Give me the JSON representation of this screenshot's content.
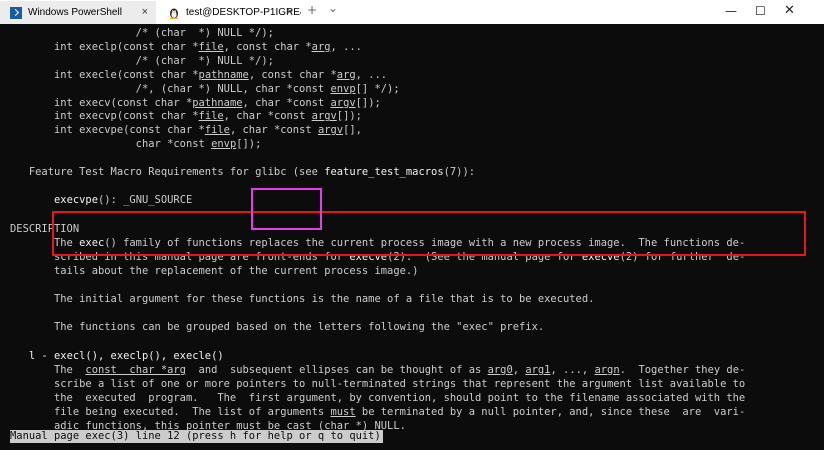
{
  "tabs": [
    {
      "title": "Windows PowerShell",
      "icon": "powershell-icon",
      "active": false
    },
    {
      "title": "test@DESKTOP-P1IGRE4: ~/data",
      "icon": "linux-penguin-icon",
      "active": true
    }
  ],
  "controls": {
    "close_glyph": "×",
    "new_tab_glyph": "+",
    "dropdown_glyph": "⌄",
    "minimize_glyph": "—",
    "maximize_glyph": "☐",
    "window_close_glyph": "✕"
  },
  "man": {
    "synopsis": [
      {
        "t": "                    /* (char  *) NULL */);"
      },
      {
        "t": "       int execlp(const char *",
        "u1": "file",
        "t2": ", const char *",
        "u2": "arg",
        "t3": ", ..."
      },
      {
        "t": "                    /* (char  *) NULL */);"
      },
      {
        "t": "       int execle(const char *",
        "u1": "pathname",
        "t2": ", const char *",
        "u2": "arg",
        "t3": ", ..."
      },
      {
        "t": "                    /*, (char *) NULL, char *const ",
        "u1": "envp",
        "t2": "[] */);"
      },
      {
        "t": "       int execv(const char *",
        "u1": "pathname",
        "t2": ", char *const ",
        "u2": "argv",
        "t3": "[]);"
      },
      {
        "t": "       int execvp(const char *",
        "u1": "file",
        "t2": ", char *const ",
        "u2": "argv",
        "t3": "[]);"
      },
      {
        "t": "       int execvpe(const char *",
        "u1": "file",
        "t2": ", char *const ",
        "u2": "argv",
        "t3": "[],"
      },
      {
        "t": "                    char *const ",
        "u1": "envp",
        "t2": "[]);"
      }
    ],
    "ftm_line_pre": "   Feature Test Macro Requirements for glibc (see ",
    "ftm_ref": "feature_test_macros",
    "ftm_line_post": "(7)):",
    "execvpe_line_pre": "       ",
    "execvpe_name": "execvpe",
    "execvpe_line_post": "(): _GNU_SOURCE",
    "desc_heading": "DESCRIPTION",
    "desc_p1": [
      {
        "t": "       The ",
        "b1": "exec",
        "t2": "() family of functions replaces the current process image with a new process image.  The functions de‐"
      },
      {
        "t": "       scribed in this manual page are front‐ends for ",
        "b1": "execve",
        "t2": "(2).  (See the manual page for ",
        "b2": "execve",
        "t3": "(2) for further  de‐"
      },
      {
        "t": "       tails about the replacement of the current process image.)"
      }
    ],
    "desc_p2": "       The initial argument for these functions is the name of a file that is to be executed.",
    "desc_p3": "       The functions can be grouped based on the letters following the \"exec\" prefix.",
    "sub_heading_pre": "   ",
    "sub_heading": "l - execl(), execlp(), execle()",
    "l_para": [
      {
        "t": "       The  ",
        "u1": "const  char *arg",
        "t2": "  and  subsequent ellipses can be thought of as ",
        "u2": "arg0",
        "t3": ", ",
        "u3": "arg1",
        "t4": ", ..., ",
        "u4": "argn",
        "t5": ".  Together they de‐"
      },
      {
        "t": "       scribe a list of one or more pointers to null‐terminated strings that represent the argument list available to"
      },
      {
        "t": "       the  executed  program.   The  first argument, by convention, should point to the filename associated with the"
      },
      {
        "t": "       file being executed.  The list of arguments ",
        "u1": "must",
        "t2": " be terminated by a null pointer, and, since these  are  vari‐"
      },
      {
        "t": "       adic functions, this pointer must be cast ",
        "u1": "(char *)",
        "t2": " NULL."
      }
    ]
  },
  "status": "Manual page exec(3) line 12 (press h for help or q to quit)",
  "annotation_colors": {
    "box_red": "#e6161e",
    "box_magenta": "#e63ce6"
  },
  "colors": {
    "terminal_bg": "#0c0c0c",
    "terminal_fg": "#cccccc"
  }
}
